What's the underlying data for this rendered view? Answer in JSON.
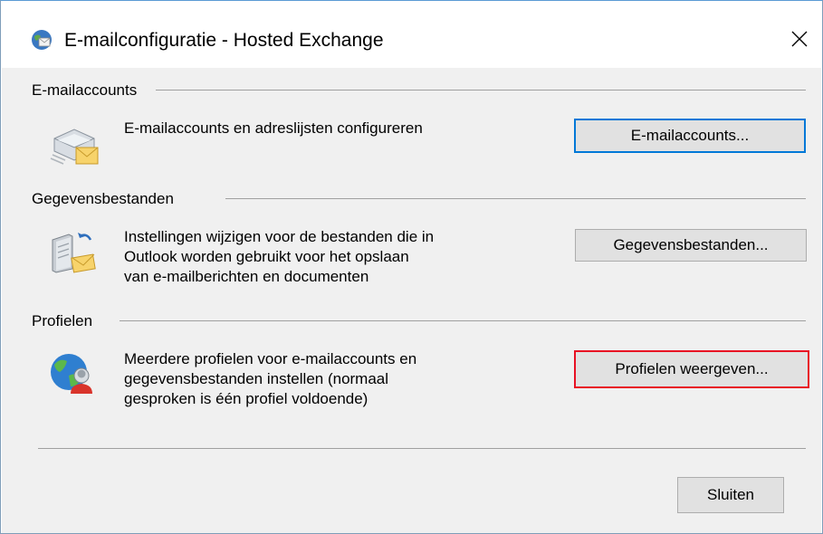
{
  "window": {
    "title": "E-mailconfiguratie - Hosted Exchange",
    "close_glyph": "✕"
  },
  "sections": {
    "email": {
      "header": "E-mailaccounts",
      "description": [
        "E-mailaccounts en adreslijsten configureren"
      ],
      "button_label": "E-mailaccounts...",
      "icon": "email-accounts-icon"
    },
    "data": {
      "header": "Gegevensbestanden",
      "description": [
        "Instellingen wijzigen voor de bestanden die in",
        "Outlook worden gebruikt voor het opslaan",
        "van e-mailberichten en documenten"
      ],
      "button_label": "Gegevensbestanden...",
      "icon": "data-files-icon"
    },
    "profiles": {
      "header": "Profielen",
      "description": [
        "Meerdere profielen voor e-mailaccounts en",
        "gegevensbestanden instellen (normaal",
        "gesproken is één profiel voldoende)"
      ],
      "button_label": "Profielen weergeven...",
      "icon": "profiles-globe-icon"
    }
  },
  "footer": {
    "close_label": "Sluiten"
  },
  "colors": {
    "default_button_border": "#0078d7",
    "highlight_border": "#e81123",
    "client_bg": "#f0f0f0"
  }
}
